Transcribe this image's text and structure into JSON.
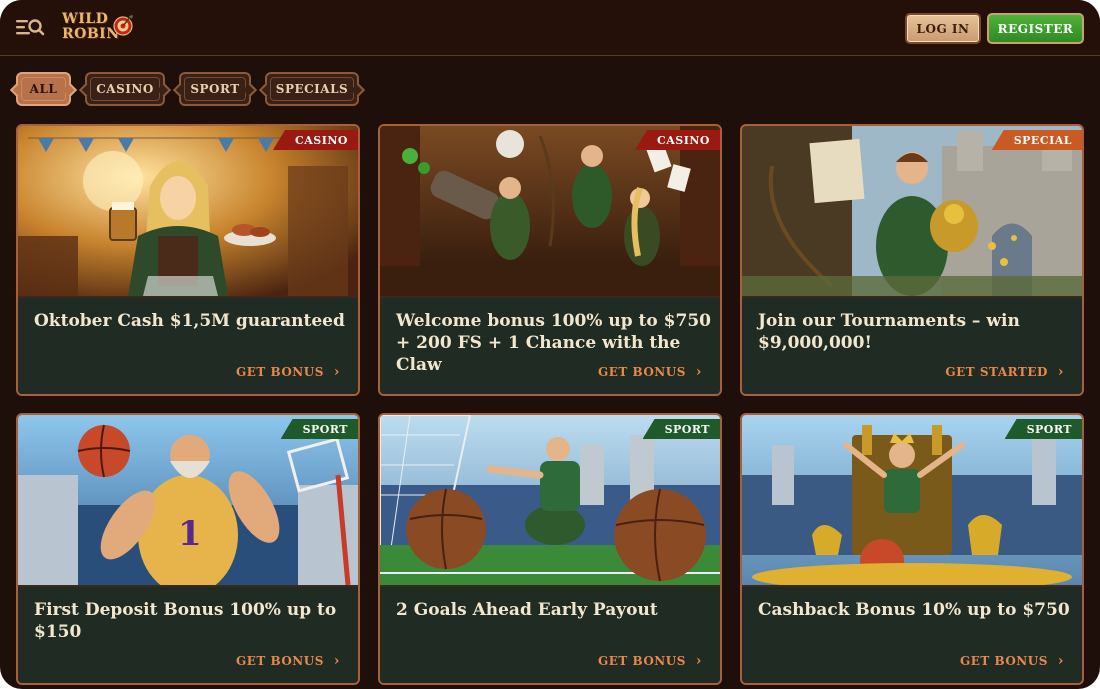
{
  "header": {
    "logo_line1": "WILD",
    "logo_line2": "ROBIN",
    "login_label": "LOG IN",
    "register_label": "REGISTER"
  },
  "filters": [
    {
      "label": "ALL",
      "active": true
    },
    {
      "label": "CASINO",
      "active": false
    },
    {
      "label": "SPORT",
      "active": false
    },
    {
      "label": "SPECIALS",
      "active": false
    }
  ],
  "cards": [
    {
      "badge": "CASINO",
      "title": "Oktober Cash $1,5M guaranteed",
      "cta": "GET BONUS"
    },
    {
      "badge": "CASINO",
      "title": "Welcome bonus 100% up to $750 + 200 FS + 1 Chance with the Claw",
      "cta": "GET BONUS"
    },
    {
      "badge": "SPECIAL",
      "title": "Join our Tournaments – win $9,000,000!",
      "cta": "GET STARTED"
    },
    {
      "badge": "SPORT",
      "title": "First Deposit Bonus 100% up to $150",
      "cta": "GET BONUS"
    },
    {
      "badge": "SPORT",
      "title": "2 Goals Ahead Early Payout",
      "cta": "GET BONUS"
    },
    {
      "badge": "SPORT",
      "title": "Cashback Bonus 10% up to $750",
      "cta": "GET BONUS"
    }
  ],
  "colors": {
    "background": "#1e0f0a",
    "card_border": "#a8603a",
    "cta": "#e8884a",
    "register": "#3d9e2e",
    "badge_casino": "#9a1a12",
    "badge_special": "#c85a22",
    "badge_sport": "#1e5a2a"
  },
  "icons": [
    "menu-search-icon",
    "target-icon",
    "chevron-right-icon"
  ]
}
